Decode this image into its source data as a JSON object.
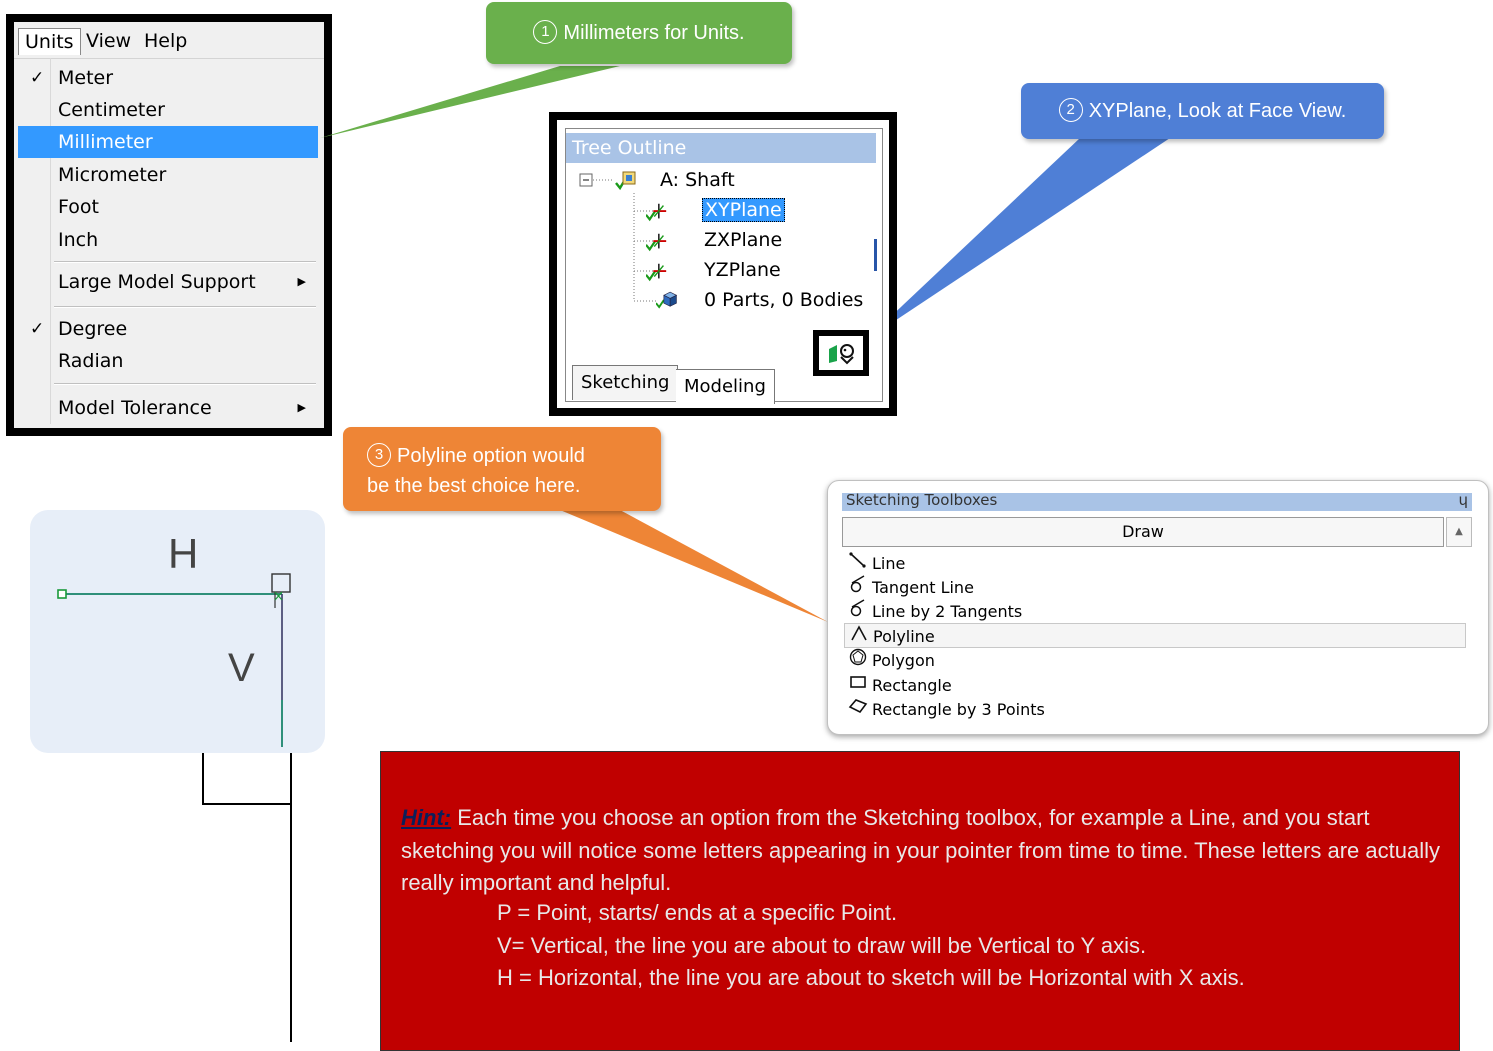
{
  "units_menu": {
    "menubar": [
      "Units",
      "View",
      "Help"
    ],
    "items": [
      {
        "label": "Meter",
        "checked": true
      },
      {
        "label": "Centimeter"
      },
      {
        "label": "Millimeter",
        "selected": true
      },
      {
        "label": "Micrometer"
      },
      {
        "label": "Foot"
      },
      {
        "label": "Inch"
      },
      {
        "label": "Large Model Support",
        "submenu": true
      },
      {
        "label": "Degree",
        "checked": true
      },
      {
        "label": "Radian"
      },
      {
        "label": "Model Tolerance",
        "submenu": true
      }
    ],
    "check_glyph": "✓",
    "submenu_glyph": "▶"
  },
  "callouts": {
    "c1": {
      "num": "1",
      "text": "Millimeters for Units."
    },
    "c2": {
      "num": "2",
      "text": "XYPlane, Look at Face View."
    },
    "c3": {
      "num": "3",
      "line1": "Polyline option would",
      "line2": "be the best choice here."
    },
    "colors": {
      "green": "#6ab04c",
      "blue": "#4f7fd6",
      "orange": "#ee8536"
    }
  },
  "tree": {
    "header": "Tree Outline",
    "root": "A: Shaft",
    "planes": [
      "XYPlane",
      "ZXPlane",
      "YZPlane"
    ],
    "parts": "0 Parts, 0 Bodies",
    "tabs": [
      "Sketching",
      "Modeling"
    ],
    "look_at_icon": "look-at-face-icon"
  },
  "sketch": {
    "letter_h": "H",
    "letter_v": "V"
  },
  "toolbox": {
    "title": "Sketching Toolboxes",
    "pin": "ɥ",
    "section": "Draw",
    "items": [
      {
        "label": "Line",
        "icon": "line-icon"
      },
      {
        "label": "Tangent Line",
        "icon": "tangent-line-icon"
      },
      {
        "label": "Line by 2 Tangents",
        "icon": "line-by-2-tangents-icon"
      },
      {
        "label": "Polyline",
        "icon": "polyline-icon",
        "highlighted": true
      },
      {
        "label": "Polygon",
        "icon": "polygon-icon"
      },
      {
        "label": "Rectangle",
        "icon": "rectangle-icon"
      },
      {
        "label": "Rectangle by 3 Points",
        "icon": "rectangle-by-3-points-icon"
      }
    ]
  },
  "hint": {
    "label": "Hint:",
    "body": " Each time you choose an option from the Sketching toolbox, for example a Line, and you start sketching you will notice some letters appearing in your pointer from time to time. These letters are actually really important and helpful.",
    "p": "P = Point, starts/ ends at a specific Point.",
    "v": "V= Vertical, the line you are about to draw will be Vertical to Y axis.",
    "h": "H = Horizontal, the line you are about to sketch will be Horizontal with X axis.",
    "background": "#c00000"
  }
}
